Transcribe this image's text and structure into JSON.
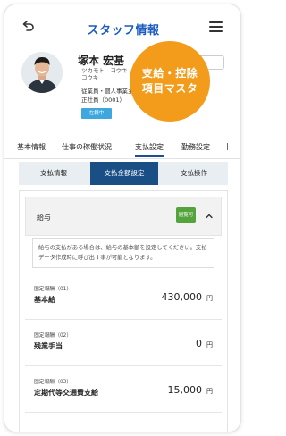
{
  "header": {
    "title": "スタッフ情報",
    "back_icon": "back-arrow-icon",
    "menu_icon": "hamburger-menu-icon"
  },
  "profile": {
    "name": "塚本 宏基",
    "kana": "ツカモト　コウキ",
    "kana2": "コウキ",
    "department": "従業員・個人事業主",
    "employee_no": "正社員（0001）",
    "status": "在籍中"
  },
  "promo": {
    "line1": "支給・控除",
    "line2": "項目マスタ"
  },
  "top_tabs": [
    {
      "label": "基本情報"
    },
    {
      "label": "仕事の稼働状況"
    },
    {
      "label": "支払設定",
      "active": true
    },
    {
      "label": "勤務設定"
    }
  ],
  "sub_tabs": [
    {
      "label": "支払情報"
    },
    {
      "label": "支払金額設定",
      "active": true
    },
    {
      "label": "支払操作"
    }
  ],
  "section": {
    "title": "給与",
    "badge": "閲覧可",
    "info": "給与の支払がある場合は、給与の基本額を設定してください。支払データ作成時に呼び出す事が可能となります。"
  },
  "pay_items": [
    {
      "sub": "固定報酬（01）",
      "name": "基本給",
      "amount": "430,000",
      "unit": "円"
    },
    {
      "sub": "固定報酬（02）",
      "name": "残業手当",
      "amount": "0",
      "unit": "円"
    },
    {
      "sub": "固定報酬（03）",
      "name": "定期代等交通費支給",
      "amount": "15,000",
      "unit": "円"
    }
  ],
  "colors": {
    "accent": "#1c5bbf",
    "tab_active": "#1a4f86",
    "promo": "#f39c1b",
    "status_badge": "#3ea7dd",
    "view_badge": "#54a33c"
  }
}
